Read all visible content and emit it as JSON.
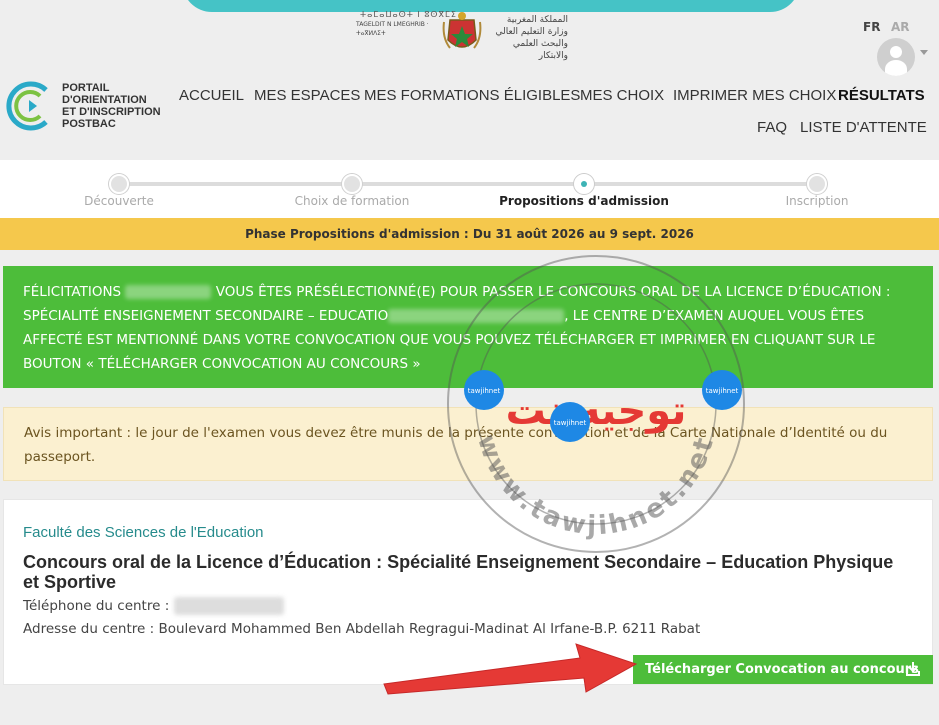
{
  "header": {
    "ministry_tifinagh": "ⵜⴰⵎⴰⵡⴰⵙⵜ ⵏ ⵓⵙⴳⵎⵉ",
    "ministry_latin": "TAGELDIT N LMEGHRIB · ⵜⴰⴳⵍⴷⵉⵜ",
    "ministry_arabic": "المملكة المغربية وزارة التعليم العالي والبحث العلمي والابتكار",
    "lang_fr": "FR",
    "lang_ar": "AR"
  },
  "logo": {
    "line1": "PORTAIL",
    "line2": "D'ORIENTATION",
    "line3": "ET D'INSCRIPTION",
    "line4": "POSTBAC"
  },
  "nav": {
    "items": [
      "ACCUEIL",
      "MES ESPACES",
      "MES FORMATIONS ÉLIGIBLES",
      "MES CHOIX",
      "IMPRIMER MES CHOIX",
      "RÉSULTATS"
    ],
    "row2": [
      "FAQ",
      "LISTE D'ATTENTE"
    ],
    "active": "RÉSULTATS"
  },
  "stepper": {
    "steps": [
      "Découverte",
      "Choix de formation",
      "Propositions d'admission",
      "Inscription"
    ],
    "current_index": 2
  },
  "phase_banner": "Phase Propositions d'admission : Du 31 août 2026 au 9 sept. 2026",
  "success_alert": {
    "part1": "Félicitations",
    "part2": "vous êtes présélectionné(e) pour passer le concours oral de la licence d’éducation : Spécialité Enseignement Secondaire – Educatio",
    "part3": ", le centre d’examen auquel vous êtes affecté est mentionné dans votre convocation que vous pouvez télécharger et imprimer en cliquant sur le bouton « Télécharger convocation au concours »"
  },
  "warning_alert": "Avis important : le jour de l'examen vous devez être munis de la présente convocation et de la Carte Nationale d’Identité ou du passeport.",
  "card": {
    "faculty": "Faculté des Sciences de l'Education",
    "title": "Concours oral de la Licence d’Éducation : Spécialité Enseignement Secondaire – Education Physique et Sportive",
    "phone_label": "Téléphone du centre :",
    "address": "Adresse du centre : Boulevard Mohammed Ben Abdellah Regragui-Madinat Al Irfane-B.P. 6211 Rabat",
    "download_button": "Télécharger Convocation au concours"
  },
  "watermark": {
    "arabic": "توجيه نت",
    "url": "www.tawjihnet.net",
    "badge": "tawjihnet"
  },
  "colors": {
    "green": "#4dbd3a",
    "teal": "#3eb3b5",
    "yellow_banner": "#f5c84c",
    "arrow_red": "#e53935"
  }
}
